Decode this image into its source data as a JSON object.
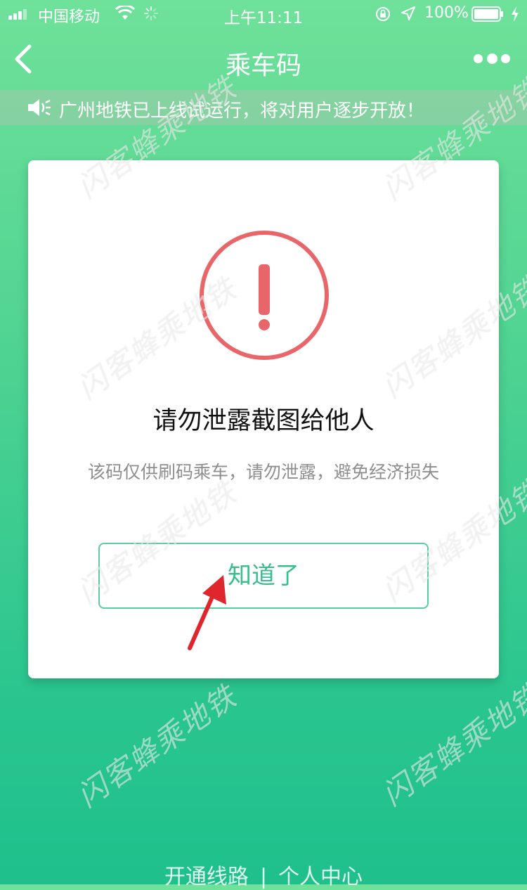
{
  "status_bar": {
    "carrier": "中国移动",
    "time": "上午11:11",
    "battery_percent": "100%"
  },
  "nav": {
    "title": "乘车码"
  },
  "notice": {
    "text": "广州地铁已上线试运行，将对用户逐步开放！"
  },
  "dialog": {
    "title": "请勿泄露截图给他人",
    "message": "该码仅供刷码乘车，请勿泄露，避免经济损失",
    "confirm_label": "知道了"
  },
  "bottom_nav": {
    "items": [
      {
        "label": "开通线路"
      },
      {
        "label": "个人中心"
      }
    ],
    "separator": "|"
  },
  "watermark": {
    "text": "闪客蜂乘地铁"
  },
  "colors": {
    "brand_green": "#37be8c",
    "warning_red": "#e8666a",
    "arrow_red": "#e0262d"
  }
}
